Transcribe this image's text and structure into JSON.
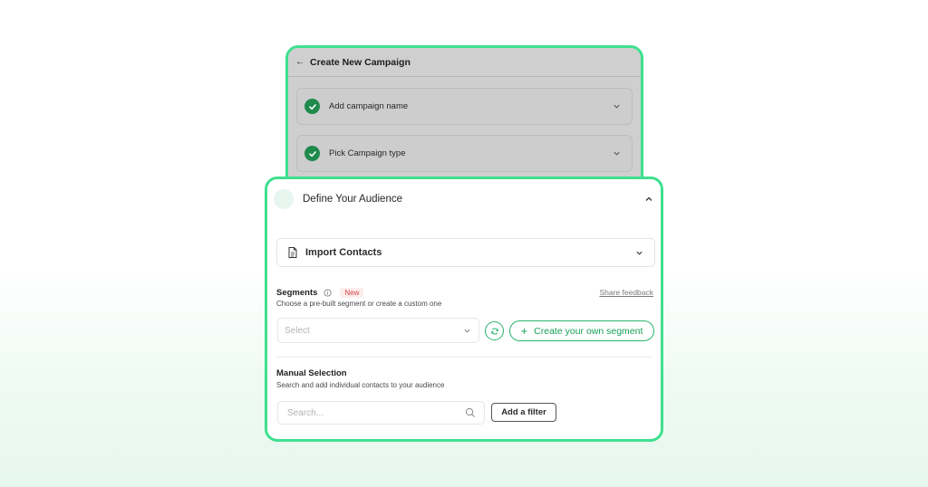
{
  "back_card": {
    "title": "Create New Campaign",
    "steps": [
      {
        "label": "Add campaign name",
        "status": "complete"
      },
      {
        "label": "Pick Campaign type",
        "status": "complete"
      }
    ]
  },
  "audience_step": {
    "title": "Define Your Audience",
    "import_contacts": {
      "label": "Import Contacts"
    },
    "segments": {
      "title": "Segments",
      "badge": "New",
      "feedback_link": "Share feedback",
      "subtitle": "Choose a pre-built segment or create a custom one",
      "select_placeholder": "Select",
      "create_button": "Create your own segment"
    },
    "manual_selection": {
      "title": "Manual Selection",
      "subtitle": "Search and add individual contacts to your audience",
      "search_placeholder": "Search...",
      "filter_button": "Add a filter"
    }
  },
  "colors": {
    "accent_border": "#3ee08f",
    "primary_green": "#17a05a",
    "check_green": "#1f8a4c",
    "badge_red": "#d64545"
  },
  "icons": [
    "back-arrow-icon",
    "check-icon",
    "chevron-down-icon",
    "chevron-up-icon",
    "document-icon",
    "info-icon",
    "refresh-icon",
    "plus-icon",
    "search-icon"
  ]
}
